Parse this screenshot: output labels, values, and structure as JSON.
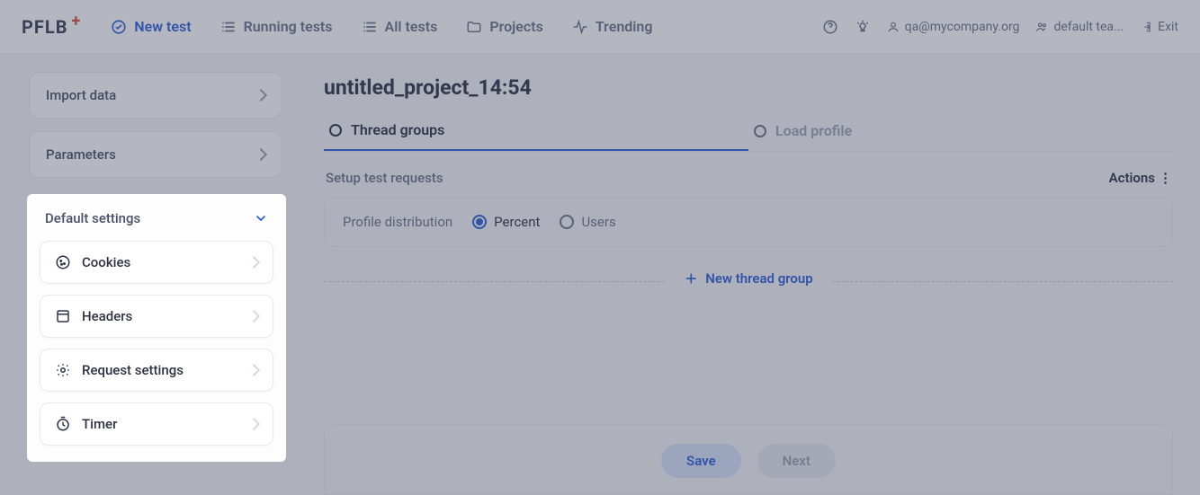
{
  "logo": {
    "text": "PFLB"
  },
  "nav": {
    "new_test": "New test",
    "running_tests": "Running tests",
    "all_tests": "All tests",
    "projects": "Projects",
    "trending": "Trending"
  },
  "header_right": {
    "user_email": "qa@mycompany.org",
    "team": "default tea...",
    "exit": "Exit"
  },
  "sidebar": {
    "import_data": "Import data",
    "parameters": "Parameters",
    "default_settings": "Default settings",
    "items": [
      {
        "label": "Cookies"
      },
      {
        "label": "Headers"
      },
      {
        "label": "Request settings"
      },
      {
        "label": "Timer"
      }
    ]
  },
  "content": {
    "project_title": "untitled_project_14:54",
    "tabs": {
      "thread_groups": "Thread groups",
      "load_profile": "Load profile"
    },
    "setup_label": "Setup test requests",
    "actions_label": "Actions",
    "profile_distribution_label": "Profile distribution",
    "dist_options": {
      "percent": "Percent",
      "users": "Users"
    },
    "new_thread_group": "New thread group",
    "save_btn": "Save",
    "next_btn": "Next"
  }
}
